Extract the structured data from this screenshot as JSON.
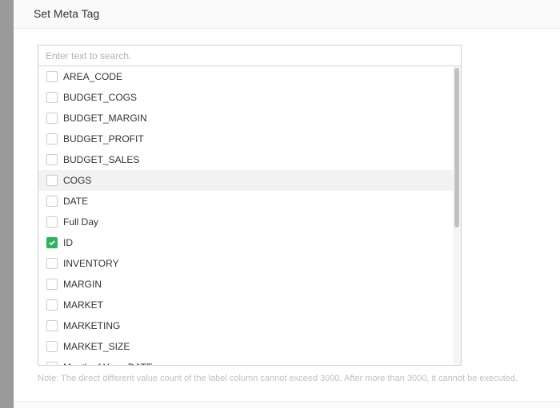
{
  "dialog": {
    "title": "Set Meta Tag"
  },
  "search": {
    "placeholder": "Enter text to search."
  },
  "items": [
    {
      "label": "AREA_CODE",
      "checked": false
    },
    {
      "label": "BUDGET_COGS",
      "checked": false
    },
    {
      "label": "BUDGET_MARGIN",
      "checked": false
    },
    {
      "label": "BUDGET_PROFIT",
      "checked": false
    },
    {
      "label": "BUDGET_SALES",
      "checked": false
    },
    {
      "label": "COGS",
      "checked": false,
      "hovered": true
    },
    {
      "label": "DATE",
      "checked": false
    },
    {
      "label": "Full Day",
      "checked": false
    },
    {
      "label": "ID",
      "checked": true
    },
    {
      "label": "INVENTORY",
      "checked": false
    },
    {
      "label": "MARGIN",
      "checked": false
    },
    {
      "label": "MARKET",
      "checked": false
    },
    {
      "label": "MARKETING",
      "checked": false
    },
    {
      "label": "MARKET_SIZE",
      "checked": false
    },
    {
      "label": "Month of Year_DATE",
      "checked": false
    }
  ],
  "note": "Note: The direct different value count of the label column cannot exceed 3000. After more than 3000, it cannot be executed.",
  "colors": {
    "checked": "#2db55d"
  }
}
